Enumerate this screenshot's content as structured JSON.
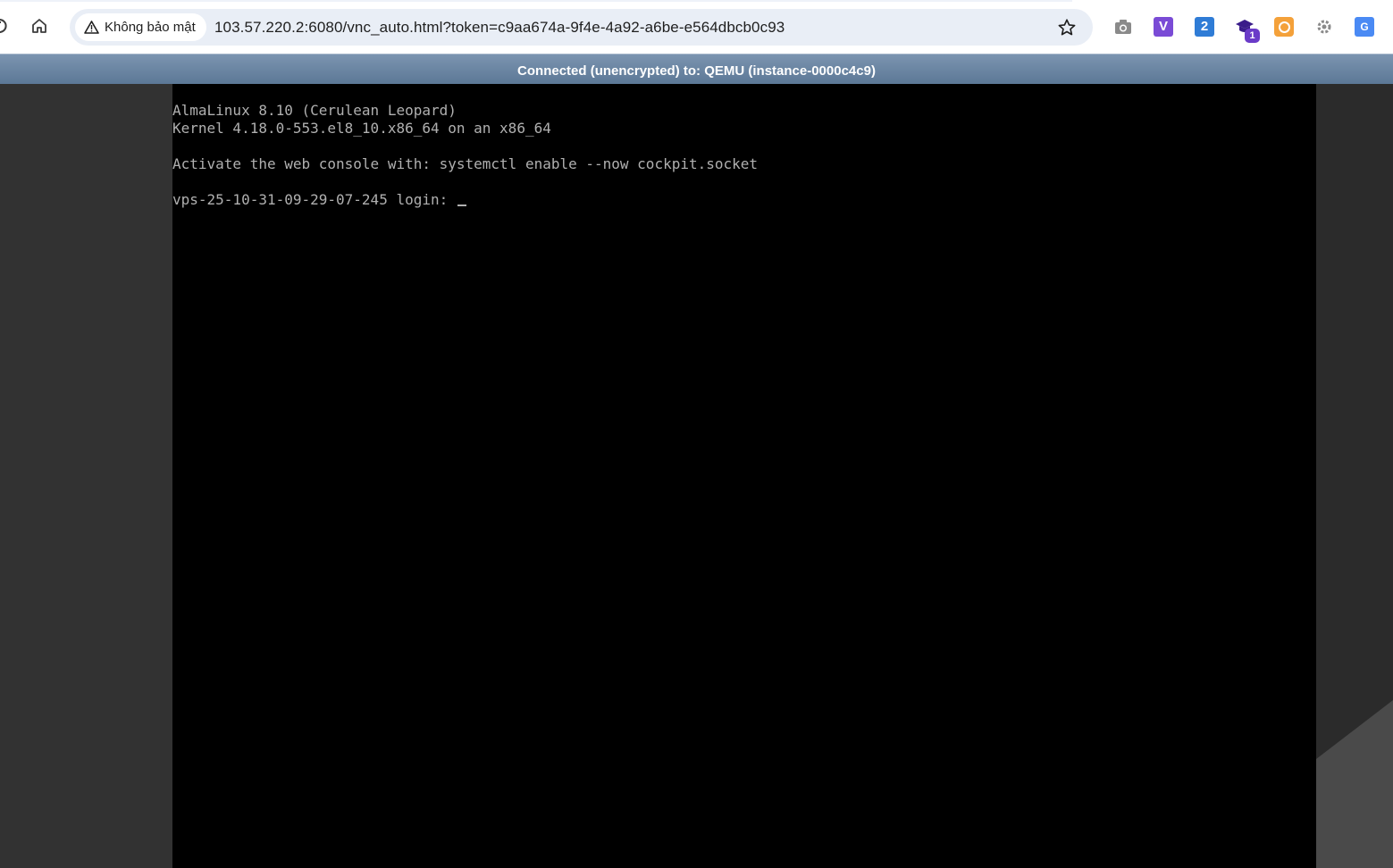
{
  "browser": {
    "security_label": "Không bảo mật",
    "url": "103.57.220.2:6080/vnc_auto.html?token=c9aa674a-9f4e-4a92-a6be-e564dbcb0c93",
    "extensions": [
      {
        "name": "camera-icon"
      },
      {
        "name": "v-extension-icon",
        "label": "V"
      },
      {
        "name": "two-extension-icon",
        "label": "2"
      },
      {
        "name": "graduation-cap-icon",
        "badge": "1"
      },
      {
        "name": "orange-extension-icon"
      },
      {
        "name": "gear-extension-icon"
      },
      {
        "name": "translate-icon",
        "label": "G"
      }
    ]
  },
  "vnc": {
    "status": "Connected (unencrypted) to: QEMU (instance-0000c4c9)"
  },
  "console": {
    "lines": [
      "AlmaLinux 8.10 (Cerulean Leopard)",
      "Kernel 4.18.0-553.el8_10.x86_64 on an x86_64",
      "",
      "Activate the web console with: systemctl enable --now cockpit.socket",
      "",
      "vps-25-10-31-09-29-07-245 login: "
    ]
  },
  "colors": {
    "status_bar": "#6b86a3",
    "background": "#323232",
    "screen": "#000000",
    "console_text": "#b0b0b0"
  }
}
